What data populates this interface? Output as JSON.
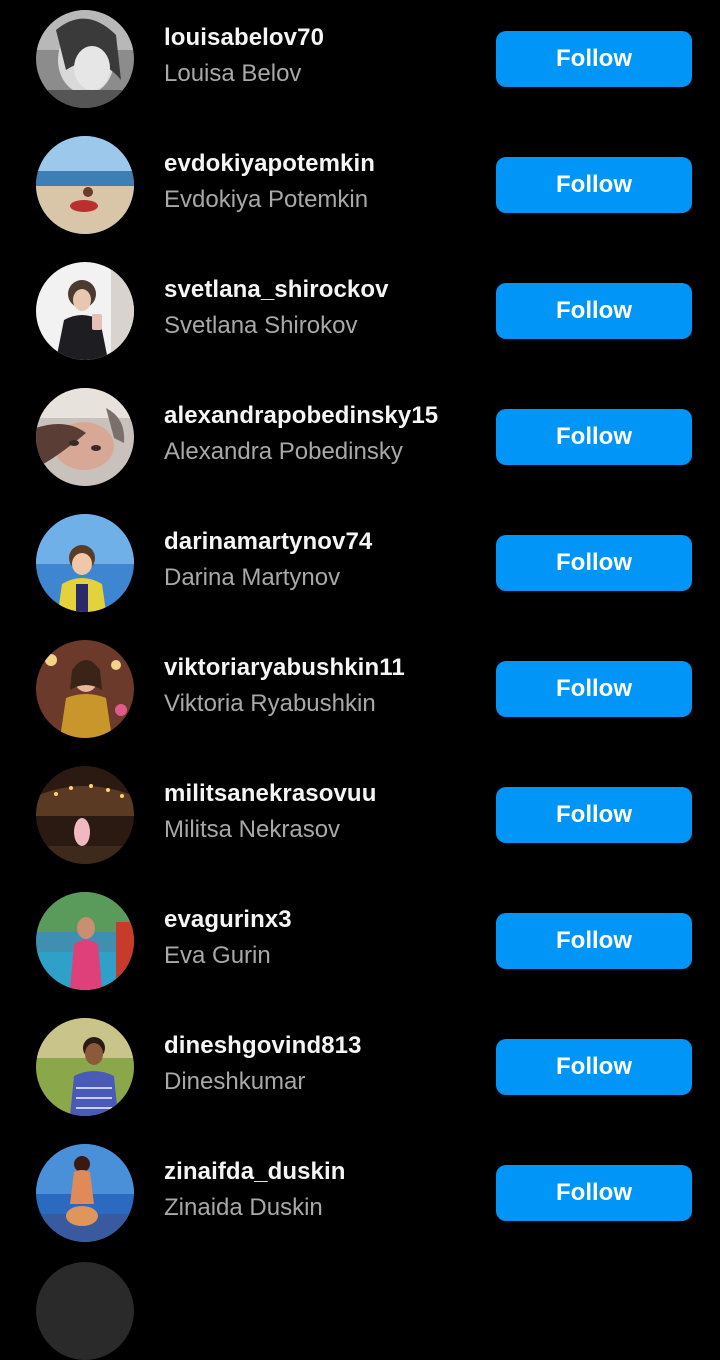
{
  "accounts": [
    {
      "username": "louisabelov70",
      "full_name": "Louisa Belov",
      "button": "Follow",
      "avatar_icon": "user-photo-grayscale-portrait"
    },
    {
      "username": "evdokiyapotemkin",
      "full_name": "Evdokiya Potemkin",
      "button": "Follow",
      "avatar_icon": "user-photo-beach"
    },
    {
      "username": "svetlana_shirockov",
      "full_name": "Svetlana Shirokov",
      "button": "Follow",
      "avatar_icon": "user-photo-mirror-selfie"
    },
    {
      "username": "alexandrapobedinsky15",
      "full_name": "Alexandra Pobedinsky",
      "button": "Follow",
      "avatar_icon": "user-photo-face-closeup"
    },
    {
      "username": "darinamartynov74",
      "full_name": "Darina Martynov",
      "button": "Follow",
      "avatar_icon": "user-photo-child-sea"
    },
    {
      "username": "viktoriaryabushkin11",
      "full_name": "Viktoria Ryabushkin",
      "button": "Follow",
      "avatar_icon": "user-photo-festive"
    },
    {
      "username": "militsanekrasovuu",
      "full_name": "Militsa Nekrasov",
      "button": "Follow",
      "avatar_icon": "user-photo-night-lights"
    },
    {
      "username": "evagurinx3",
      "full_name": "Eva Gurin",
      "button": "Follow",
      "avatar_icon": "user-photo-pool"
    },
    {
      "username": "dineshgovind813",
      "full_name": "Dineshkumar",
      "button": "Follow",
      "avatar_icon": "user-photo-man-outdoors"
    },
    {
      "username": "zinaifda_duskin",
      "full_name": "Zinaida Duskin",
      "button": "Follow",
      "avatar_icon": "user-photo-sunset"
    }
  ],
  "colors": {
    "background": "#000000",
    "button": "#0095f6",
    "username": "#f5f5f5",
    "fullname": "#a8a8a8"
  }
}
